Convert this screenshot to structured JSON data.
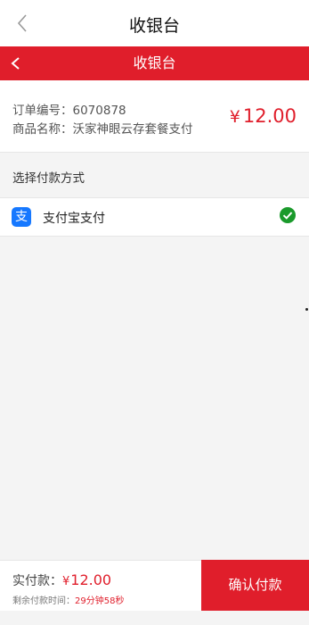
{
  "system_bar": {
    "title": "收银台"
  },
  "header": {
    "title": "收银台"
  },
  "order": {
    "number_label": "订单编号：",
    "number_value": "6070878",
    "product_label": "商品名称：",
    "product_value": "沃家神眼云存套餐支付",
    "currency": "¥",
    "amount": "12.00"
  },
  "payment": {
    "section_title": "选择付款方式",
    "methods": [
      {
        "icon": "alipay-icon",
        "icon_glyph": "支",
        "label": "支付宝支付",
        "selected": true
      }
    ]
  },
  "footer": {
    "paid_label": "实付款：",
    "currency": "¥",
    "amount": "12.00",
    "time_label": "剩余付款时间：",
    "time_value": "29分钟58秒",
    "confirm_label": "确认付款"
  },
  "colors": {
    "brand_red": "#e01e2b",
    "alipay_blue": "#1678ff",
    "check_green": "#1a9a2b"
  }
}
